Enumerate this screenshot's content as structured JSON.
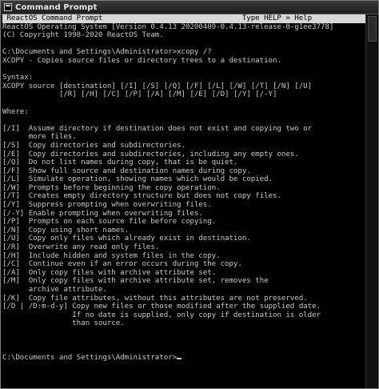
{
  "window": {
    "title": "Command Prompt"
  },
  "console": {
    "header": " ReactOS Command Prompt                                Type HELP = Help ",
    "lines": [
      "ReactOS Operating System [Version 0.4.13 20200409-0.4.13-release-0-g1ee3778]",
      "(C) Copyright 1998-2020 ReactOS Team.",
      "",
      "C:\\Documents and Settings\\Administrator>xcopy /?",
      "XCOPY - Copies source files or directory trees to a destination.",
      "",
      "Syntax:",
      "XCOPY source [destination] [/I] [/S] [/Q] [/F] [/L] [/W] [/T] [/N] [/U]",
      "             [/R] [/H] [/C] [/P] [/A] [/M] [/E] [/D] [/Y] [/-Y]",
      "",
      "Where:",
      "",
      "[/I]  Assume directory if destination does not exist and copying two or",
      "      more files.",
      "[/S]  Copy directories and subdirectories.",
      "[/E]  Copy directories and subdirectories, including any empty ones.",
      "[/Q]  Do not list names during copy, that is be quiet.",
      "[/F]  Show full source and destination names during copy.",
      "[/L]  Simulate operation, showing names which would be copied.",
      "[/W]  Prompts before beginning the copy operation.",
      "[/T]  Creates empty directory structure but does not copy files.",
      "[/Y]  Suppress prompting when overwriting files.",
      "[/-Y] Enable prompting when overwriting files.",
      "[/P]  Prompts on each source file before copying.",
      "[/N]  Copy using short names.",
      "[/U]  Copy only files which already exist in destination.",
      "[/R]  Overwrite any read only files.",
      "[/H]  Include hidden and system files in the copy.",
      "[/C]  Continue even if an error occurs during the copy.",
      "[/A]  Only copy files with archive attribute set.",
      "[/M]  Only copy files with archive attribute set, removes the",
      "      archive attribute.",
      "[/K]  Copy file attributes, without this attributes are not preserved.",
      "[/D | /D:m-d-y] Copy new files or those modified after the supplied date.",
      "                If no date is supplied, only copy if destination is older",
      "                than source.",
      "",
      "",
      "",
      "C:\\Documents and Settings\\Administrator>"
    ]
  }
}
